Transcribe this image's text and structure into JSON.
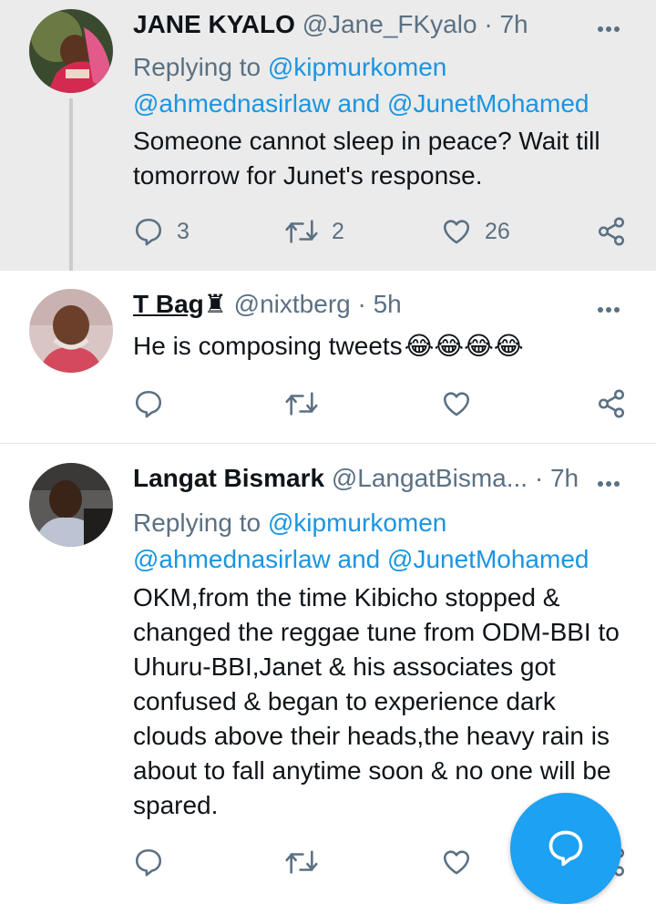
{
  "colors": {
    "accent": "#1da1f2",
    "link": "#1b95e0",
    "muted": "#5b7083"
  },
  "tweets": [
    {
      "name": "JANE KYALO",
      "handle": "@Jane_FKyalo",
      "dot": "·",
      "time": "7h",
      "replying_prefix": "Replying to",
      "replying_user": "@kipmurkomen",
      "replying_others_1": "@ahmednasirlaw",
      "replying_and": "and",
      "replying_others_2": "@JunetMohamed",
      "text_line1": "Someone cannot sleep in peace? Wait till",
      "text_line2": "tomorrow for Junet's response.",
      "reply_count": "3",
      "retweet_count": "2",
      "like_count": "26"
    },
    {
      "name": "T Bag",
      "name_icon": "♜",
      "handle": "@nixtberg",
      "dot": "·",
      "time": "5h",
      "text": "He is composing tweets",
      "emojis": "😂😂😂😂",
      "reply_count": "",
      "retweet_count": "",
      "like_count": ""
    },
    {
      "name": "Langat Bismark",
      "handle": "@LangatBisma...",
      "dot": "·",
      "time": "7h",
      "replying_prefix": "Replying to",
      "replying_user": "@kipmurkomen",
      "replying_others_1": "@ahmednasirlaw",
      "replying_and": "and",
      "replying_others_2": "@JunetMohamed",
      "lines": [
        "OKM,from the time Kibicho stopped &",
        "changed the reggae tune from ODM-BBI to",
        "Uhuru-BBI,Janet & his associates got",
        "confused & began to experience dark",
        "clouds above their heads,the heavy rain is",
        "about to fall anytime soon & no one will be",
        "spared."
      ]
    }
  ],
  "icons": {
    "reply": "reply-icon",
    "retweet": "retweet-icon",
    "like": "heart-icon",
    "share": "share-icon",
    "more": "more-icon",
    "compose": "compose-reply-icon"
  }
}
